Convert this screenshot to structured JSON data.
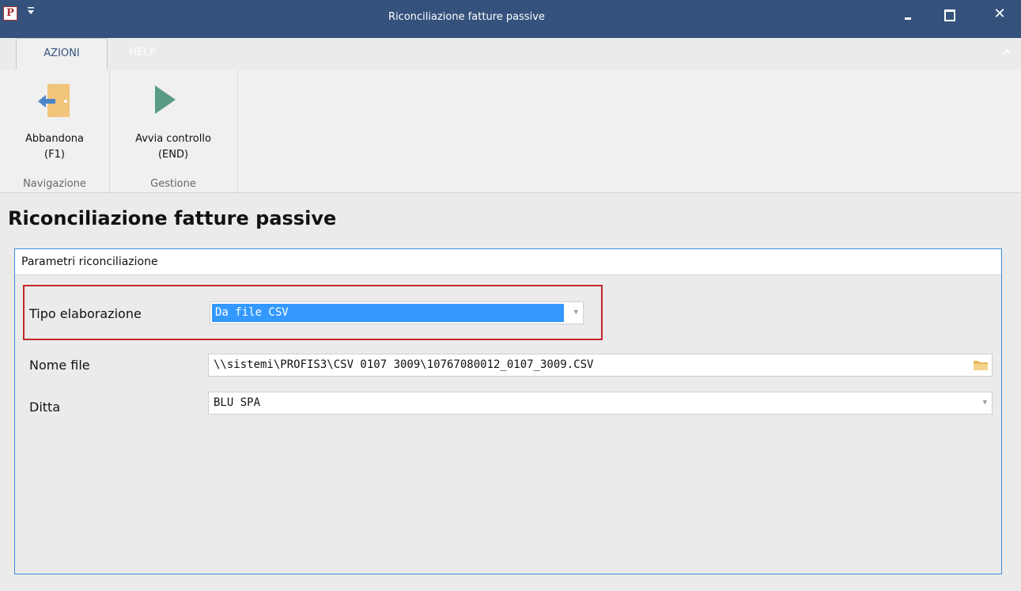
{
  "window": {
    "app_icon_letter": "P",
    "qat_icon": "quick-access-dropdown-icon",
    "title": "Riconciliazione fatture passive",
    "close_glyph": "✕"
  },
  "ribbon": {
    "tabs": [
      {
        "label": "AZIONI",
        "active": true
      },
      {
        "label": "HELP",
        "active": false
      }
    ],
    "collapse_glyph": "^",
    "groups": [
      {
        "label": "Navigazione",
        "button": {
          "label_line1": "Abbandona",
          "label_line2": "(F1)",
          "icon": "exit-door-icon"
        }
      },
      {
        "label": "Gestione",
        "button": {
          "label_line1": "Avvia controllo",
          "label_line2": "(END)",
          "icon": "play-icon"
        }
      }
    ]
  },
  "page": {
    "title": "Riconciliazione fatture passive"
  },
  "panel": {
    "header": "Parametri riconciliazione",
    "fields": {
      "tipo": {
        "label": "Tipo elaborazione",
        "value": "Da file CSV"
      },
      "nome": {
        "label": "Nome file",
        "value": "\\\\sistemi\\PROFIS3\\CSV 0107 3009\\10767080012_0107_3009.CSV"
      },
      "ditta": {
        "label": "Ditta",
        "value": "BLU SPA"
      }
    },
    "dropdown_glyph": "▼"
  },
  "colors": {
    "titlebar": "#35527d",
    "highlight_border": "#c0282e",
    "selection": "#3399ff",
    "panel_border": "#3a8fde"
  }
}
